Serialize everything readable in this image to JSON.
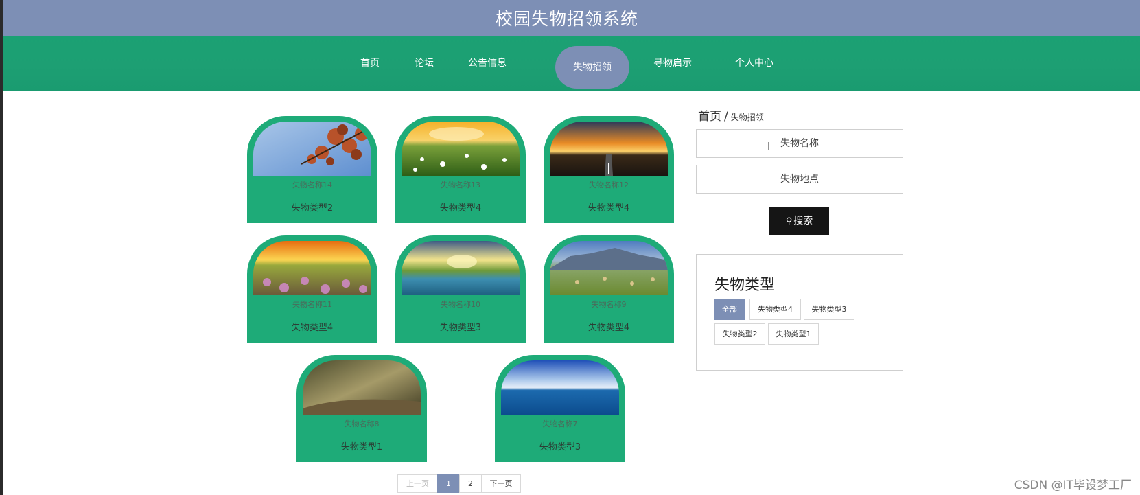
{
  "header": {
    "title": "校园失物招领系统"
  },
  "nav": {
    "items": [
      {
        "label": "首页",
        "active": false
      },
      {
        "label": "论坛",
        "active": false
      },
      {
        "label": "公告信息",
        "active": false
      },
      {
        "label": "失物招领",
        "active": true
      },
      {
        "label": "寻物启示",
        "active": false
      },
      {
        "label": "个人中心",
        "active": false
      }
    ]
  },
  "items": [
    {
      "name": "失物名称14",
      "type": "失物类型2",
      "image": "autumn-leaves-photo"
    },
    {
      "name": "失物名称13",
      "type": "失物类型4",
      "image": "sunset-flower-field-photo"
    },
    {
      "name": "失物名称12",
      "type": "失物类型4",
      "image": "sunset-road-photo"
    },
    {
      "name": "失物名称11",
      "type": "失物类型4",
      "image": "sunrise-meadow-photo"
    },
    {
      "name": "失物名称10",
      "type": "失物类型3",
      "image": "lake-sunburst-photo"
    },
    {
      "name": "失物名称9",
      "type": "失物类型4",
      "image": "mountain-field-photo"
    },
    {
      "name": "失物名称8",
      "type": "失物类型1",
      "image": "forest-path-photo"
    },
    {
      "name": "失物名称7",
      "type": "失物类型3",
      "image": "ocean-sky-photo"
    }
  ],
  "pagination": {
    "prev": "上一页",
    "pages": [
      "1",
      "2"
    ],
    "current": "1",
    "next": "下一页"
  },
  "breadcrumb": {
    "home": "首页",
    "separator": "/",
    "current": "失物招领"
  },
  "search": {
    "name_placeholder": "失物名称",
    "location_placeholder": "失物地点",
    "button_label": "搜索",
    "button_icon": "search-icon"
  },
  "type_filter": {
    "title": "失物类型",
    "tags": [
      {
        "label": "全部",
        "active": true
      },
      {
        "label": "失物类型4",
        "active": false
      },
      {
        "label": "失物类型3",
        "active": false
      },
      {
        "label": "失物类型2",
        "active": false
      },
      {
        "label": "失物类型1",
        "active": false
      }
    ]
  },
  "watermark": "CSDN @IT毕设梦工厂",
  "colors": {
    "header": "#7d8fb5",
    "nav": "#1d9f73",
    "card": "#1eab78",
    "accent": "#7d8fb5"
  }
}
